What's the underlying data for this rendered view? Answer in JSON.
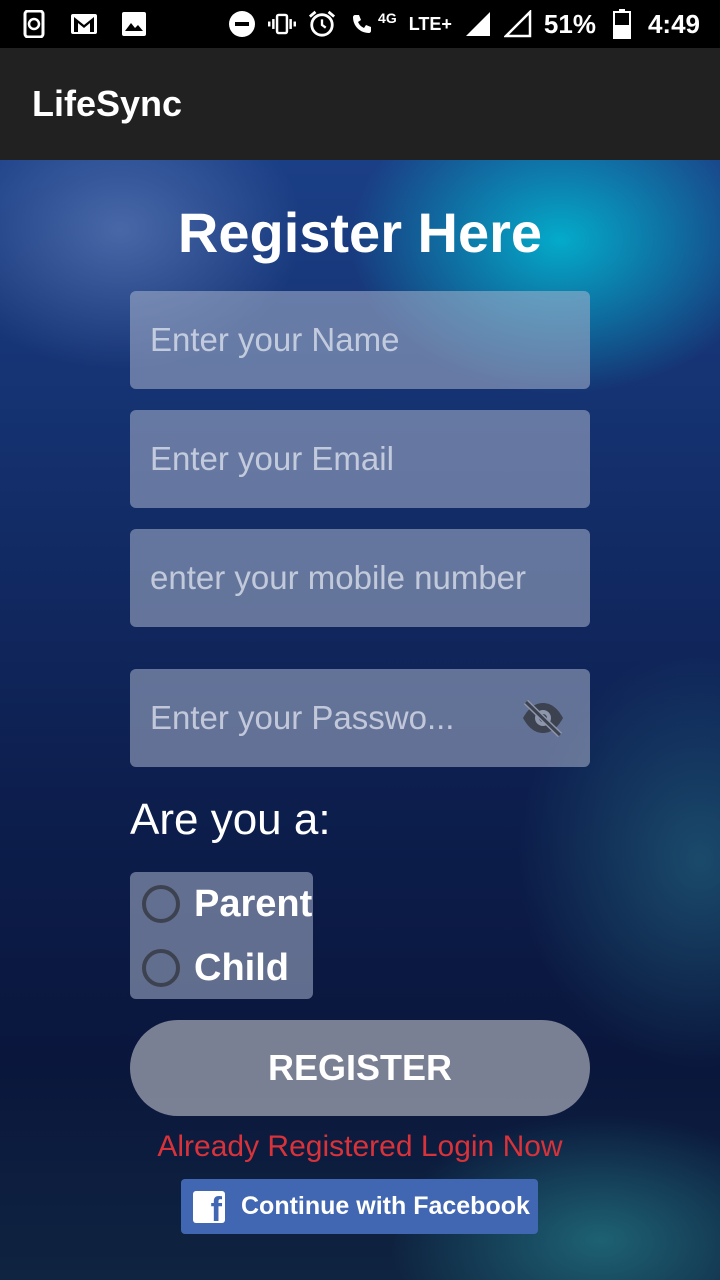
{
  "status_bar": {
    "network_label": "4G",
    "lte_label": "LTE+",
    "battery": "51%",
    "time": "4:49",
    "icons": [
      "sync-phone-icon",
      "gmail-icon",
      "image-icon",
      "dnd-icon",
      "vibrate-icon",
      "alarm-icon",
      "volte-call-icon",
      "signal-icon",
      "signal-icon-2",
      "battery-icon"
    ]
  },
  "app_bar": {
    "title": "LifeSync"
  },
  "form": {
    "title": "Register Here",
    "name_placeholder": "Enter your Name",
    "email_placeholder": "Enter your Email",
    "mobile_placeholder": "enter your mobile number",
    "password_placeholder": "Enter your Passwo...",
    "password_toggle_icon": "visibility-off-icon",
    "role_question": "Are you a:",
    "roles": [
      {
        "label": "Parent",
        "selected": false
      },
      {
        "label": "Child",
        "selected": false
      }
    ],
    "register_label": "REGISTER",
    "login_link": "Already Registered Login Now",
    "facebook_label": "Continue with Facebook"
  },
  "colors": {
    "app_bar_bg": "#212121",
    "login_link": "#d8323a",
    "facebook_blue": "#4267b2"
  }
}
